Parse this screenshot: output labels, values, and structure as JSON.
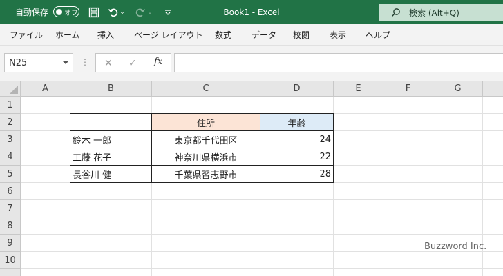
{
  "titlebar": {
    "autosave_label": "自動保存",
    "autosave_state": "オフ",
    "title": "Book1  -  Excel",
    "search_placeholder": "検索 (Alt+Q)",
    "color": "#217346"
  },
  "ribbon": {
    "tabs": [
      "ファイル",
      "ホーム",
      "挿入",
      "ページ レイアウト",
      "数式",
      "データ",
      "校閲",
      "表示",
      "ヘルプ"
    ]
  },
  "formula_bar": {
    "name_box": "N25",
    "fx_label": "fx",
    "formula_value": ""
  },
  "sheet": {
    "columns": [
      "A",
      "B",
      "C",
      "D",
      "E",
      "F",
      "G"
    ],
    "rows": [
      "1",
      "2",
      "3",
      "4",
      "5",
      "6",
      "7",
      "8",
      "9",
      "10"
    ],
    "table": {
      "header": [
        "住所",
        "年齢"
      ],
      "header_colors": [
        "#fce4d6",
        "#ddebf7"
      ],
      "records": [
        {
          "name": "鈴木 一郎",
          "address": "東京都千代田区",
          "age": "24"
        },
        {
          "name": "工藤 花子",
          "address": "神奈川県横浜市",
          "age": "22"
        },
        {
          "name": "長谷川 健",
          "address": "千葉県習志野市",
          "age": "28"
        }
      ]
    }
  },
  "watermark": "Buzzword Inc."
}
